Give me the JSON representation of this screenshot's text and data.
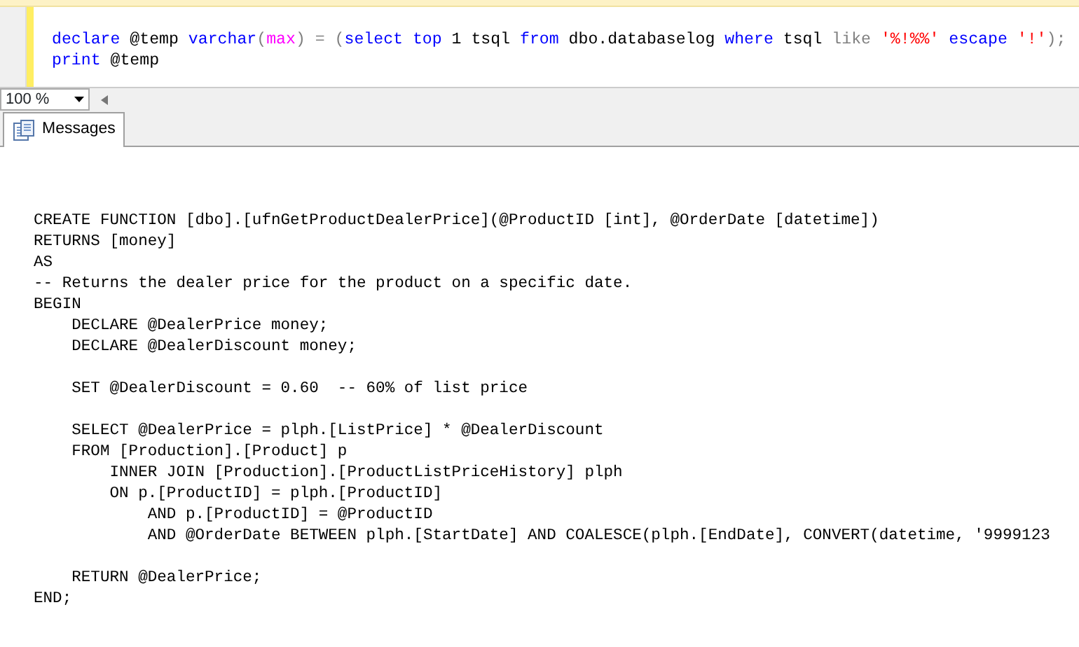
{
  "editor": {
    "lines": [
      [
        {
          "t": "declare",
          "kind": "keyword"
        },
        {
          "t": " @temp ",
          "kind": "plain"
        },
        {
          "t": "varchar",
          "kind": "keyword"
        },
        {
          "t": "(",
          "kind": "operator"
        },
        {
          "t": "max",
          "kind": "function"
        },
        {
          "t": ") = (",
          "kind": "operator"
        },
        {
          "t": "select top",
          "kind": "keyword"
        },
        {
          "t": " 1 tsql ",
          "kind": "plain"
        },
        {
          "t": "from",
          "kind": "keyword"
        },
        {
          "t": " dbo.databaselog ",
          "kind": "plain"
        },
        {
          "t": "where",
          "kind": "keyword"
        },
        {
          "t": " tsql ",
          "kind": "plain"
        },
        {
          "t": "like ",
          "kind": "operator"
        },
        {
          "t": "'%!%%'",
          "kind": "string"
        },
        {
          "t": " escape ",
          "kind": "keyword"
        },
        {
          "t": "'!'",
          "kind": "string"
        },
        {
          "t": ");",
          "kind": "operator"
        }
      ],
      [
        {
          "t": "print",
          "kind": "keyword"
        },
        {
          "t": " @temp",
          "kind": "plain"
        }
      ]
    ]
  },
  "zoom": {
    "value": "100 %"
  },
  "tabs": [
    {
      "label": "Messages",
      "selected": true
    }
  ],
  "messages": [
    {
      "kind": "code",
      "text": "CREATE FUNCTION [dbo].[ufnGetProductDealerPrice](@ProductID [int], @OrderDate [datetime])"
    },
    {
      "kind": "code",
      "text": "RETURNS [money]"
    },
    {
      "kind": "code",
      "text": "AS"
    },
    {
      "kind": "code",
      "text": "-- Returns the dealer price for the product on a specific date."
    },
    {
      "kind": "code",
      "text": "BEGIN"
    },
    {
      "kind": "code",
      "text": "    DECLARE @DealerPrice money;"
    },
    {
      "kind": "code",
      "text": "    DECLARE @DealerDiscount money;"
    },
    {
      "kind": "blank"
    },
    {
      "kind": "code",
      "text": "    SET @DealerDiscount = 0.60  -- 60% of list price"
    },
    {
      "kind": "blank"
    },
    {
      "kind": "code",
      "text": "    SELECT @DealerPrice = plph.[ListPrice] * @DealerDiscount"
    },
    {
      "kind": "code",
      "text": "    FROM [Production].[Product] p"
    },
    {
      "kind": "code",
      "text": "        INNER JOIN [Production].[ProductListPriceHistory] plph"
    },
    {
      "kind": "code",
      "text": "        ON p.[ProductID] = plph.[ProductID]"
    },
    {
      "kind": "code",
      "text": "            AND p.[ProductID] = @ProductID"
    },
    {
      "kind": "code",
      "text": "            AND @OrderDate BETWEEN plph.[StartDate] AND COALESCE(plph.[EndDate], CONVERT(datetime, '9999123"
    },
    {
      "kind": "blank"
    },
    {
      "kind": "code",
      "text": "    RETURN @DealerPrice;"
    },
    {
      "kind": "code",
      "text": "END;"
    }
  ]
}
